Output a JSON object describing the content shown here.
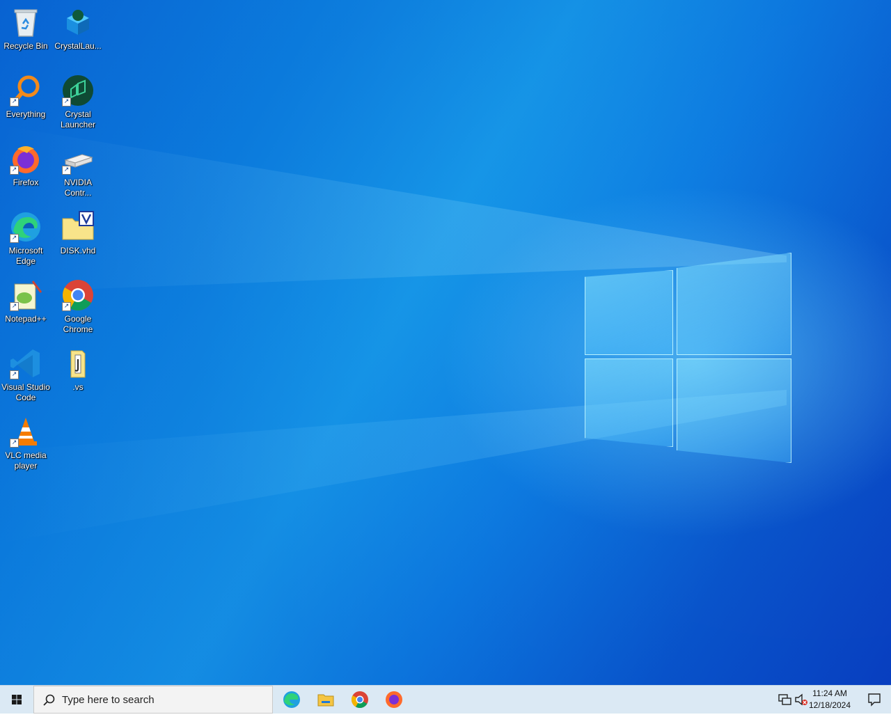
{
  "desktop": {
    "icons": [
      {
        "label": "Recycle Bin",
        "icon": "recycle-bin-icon"
      },
      {
        "label": "CrystalLau...",
        "icon": "crystal-launcher-icon"
      },
      {
        "label": "Everything",
        "icon": "everything-search-icon"
      },
      {
        "label": "Crystal Launcher",
        "icon": "crystal-launcher-icon"
      },
      {
        "label": "Firefox",
        "icon": "firefox-icon"
      },
      {
        "label": "NVIDIA Contr...",
        "icon": "nvidia-control-panel-icon"
      },
      {
        "label": "Microsoft Edge",
        "icon": "edge-icon"
      },
      {
        "label": "DISK.vhd",
        "icon": "vhd-file-icon"
      },
      {
        "label": "Notepad++",
        "icon": "notepad-plus-plus-icon"
      },
      {
        "label": "Google Chrome",
        "icon": "chrome-icon"
      },
      {
        "label": "Visual Studio Code",
        "icon": "vscode-icon"
      },
      {
        "label": ".vs",
        "icon": "folder-icon"
      },
      {
        "label": "VLC media player",
        "icon": "vlc-icon"
      }
    ]
  },
  "taskbar": {
    "search_placeholder": "Type here to search",
    "pinned_apps": [
      "Microsoft Edge",
      "File Explorer",
      "Google Chrome",
      "Firefox"
    ],
    "clock": {
      "time": "11:24 AM",
      "date": "12/18/2024"
    }
  },
  "colors": {
    "taskbar_bg": "#dbe9f4",
    "desktop_accent": "#0f8fe6"
  }
}
